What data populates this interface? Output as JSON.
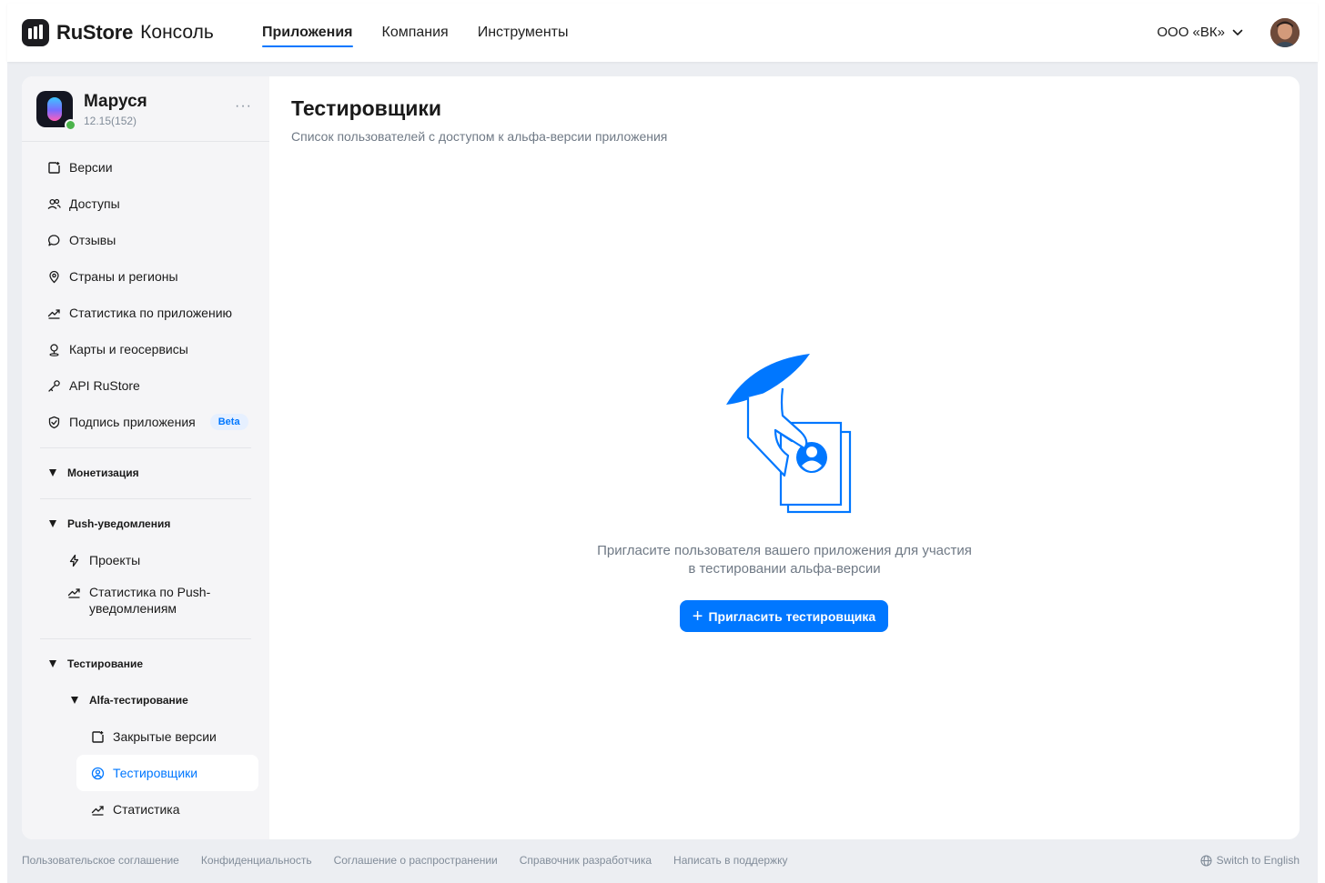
{
  "header": {
    "brand": "RuStore",
    "brand_sub": "Консоль",
    "nav": [
      "Приложения",
      "Компания",
      "Инструменты"
    ],
    "org": "ООО «ВК»"
  },
  "app": {
    "name": "Маруся",
    "version": "12.15(152)",
    "more": "···"
  },
  "sidebar": {
    "items": [
      {
        "label": "Версии",
        "icon": "versions-icon"
      },
      {
        "label": "Доступы",
        "icon": "users-icon"
      },
      {
        "label": "Отзывы",
        "icon": "reviews-icon"
      },
      {
        "label": "Страны и регионы",
        "icon": "location-icon"
      },
      {
        "label": "Статистика по приложению",
        "icon": "stats-icon"
      },
      {
        "label": "Карты и геосервисы",
        "icon": "map-pin-icon"
      },
      {
        "label": "API RuStore",
        "icon": "key-icon"
      },
      {
        "label": "Подпись приложения",
        "icon": "shield-icon",
        "badge": "Beta"
      }
    ],
    "monetization": "Монетизация",
    "push": {
      "label": "Push-уведомления",
      "items": [
        {
          "label": "Проекты",
          "icon": "lightning-icon"
        },
        {
          "label_1": "Статистика по Push-",
          "label_2": "уведомлениям",
          "icon": "stats-icon"
        }
      ]
    },
    "testing": {
      "label": "Тестирование",
      "alfa": "Alfa-тестирование",
      "items": [
        {
          "label": "Закрытые версии",
          "icon": "versions-icon"
        },
        {
          "label": "Тестировщики",
          "icon": "user-circle-icon",
          "active": true
        },
        {
          "label": "Статистика",
          "icon": "stats-icon"
        }
      ]
    }
  },
  "main": {
    "title": "Тестировщики",
    "subtitle": "Список пользователей с доступом к альфа-версии приложения",
    "empty_line_1": "Пригласите пользователя вашего приложения для участия",
    "empty_line_2": "в тестировании альфа-версии",
    "invite_button": "Пригласить тестировщика"
  },
  "footer": {
    "links": [
      "Пользовательское соглашение",
      "Конфиденциальность",
      "Соглашение о распространении",
      "Справочник разработчика",
      "Написать в поддержку"
    ],
    "language": "Switch to English"
  },
  "colors": {
    "accent": "#0077ff",
    "background": "#eceef2",
    "sidebar": "#f5f5f7",
    "muted_text": "#818c99",
    "status_online": "#4bb34b"
  }
}
